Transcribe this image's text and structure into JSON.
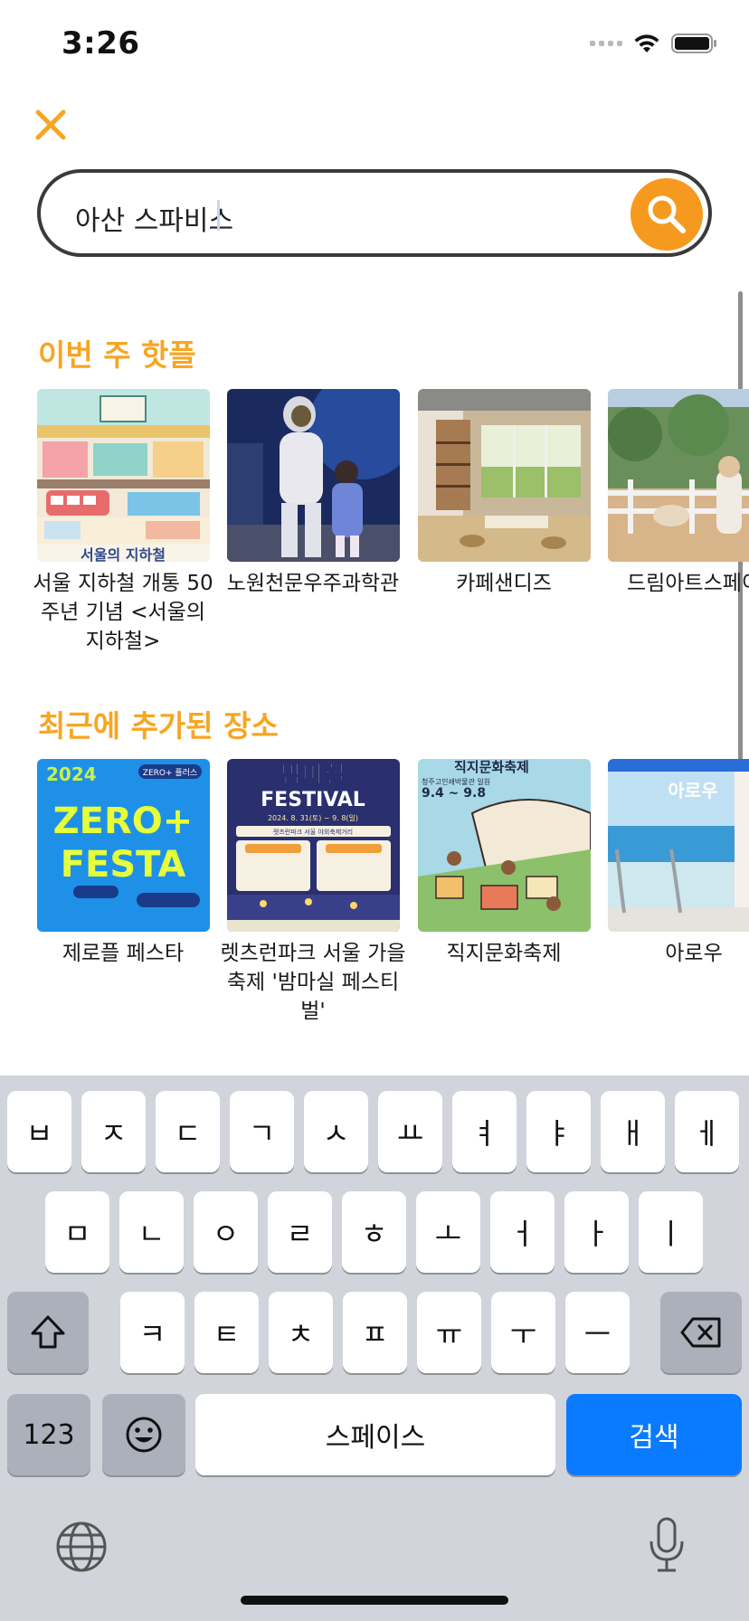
{
  "status": {
    "time": "3:26"
  },
  "search": {
    "value": "아산 스파비스"
  },
  "sections": [
    {
      "title": "이번 주 핫플",
      "cards": [
        {
          "label": "서울 지하철 개통 50주년 기념 <서울의 지하철>",
          "thumb_caption": "서울의 지하철"
        },
        {
          "label": "노원천문우주과학관"
        },
        {
          "label": "카페샌디즈"
        },
        {
          "label": "드림아트스페이"
        }
      ]
    },
    {
      "title": "최근에 추가된 장소",
      "cards": [
        {
          "label": "제로플 페스타",
          "thumb_text": [
            "2024",
            "ZERO+",
            "FESTA",
            "ZERO+ 플러스"
          ]
        },
        {
          "label": "렛츠런파크 서울 가을축제 '밤마실 페스티벌'",
          "thumb_text": [
            "밤마실",
            "FESTIVAL",
            "2024. 8. 31(토) ~ 9. 8(일)",
            "렛츠런파크 서울 야외축제거리"
          ]
        },
        {
          "label": "직지문화축제",
          "thumb_text": [
            "직지문화축제",
            "9.4 ~ 9.8",
            "청주고인쇄박물관 일원"
          ]
        },
        {
          "label": "아로우",
          "thumb_text": [
            "아로우"
          ]
        }
      ]
    }
  ],
  "keyboard": {
    "row1": [
      "ㅂ",
      "ㅈ",
      "ㄷ",
      "ㄱ",
      "ㅅ",
      "ㅛ",
      "ㅕ",
      "ㅑ",
      "ㅐ",
      "ㅔ"
    ],
    "row2": [
      "ㅁ",
      "ㄴ",
      "ㅇ",
      "ㄹ",
      "ㅎ",
      "ㅗ",
      "ㅓ",
      "ㅏ",
      "ㅣ"
    ],
    "row3": [
      "ㅋ",
      "ㅌ",
      "ㅊ",
      "ㅍ",
      "ㅠ",
      "ㅜ",
      "ㅡ"
    ],
    "numbers": "123",
    "space": "스페이스",
    "search": "검색"
  },
  "colors": {
    "accent": "#f6a623",
    "search_button": "#f69a1f",
    "keyboard_action": "#0a7bff"
  },
  "icons": [
    "close-icon",
    "search-icon",
    "shift-icon",
    "backspace-icon",
    "emoji-icon",
    "globe-icon",
    "microphone-icon",
    "wifi-icon",
    "battery-icon"
  ]
}
